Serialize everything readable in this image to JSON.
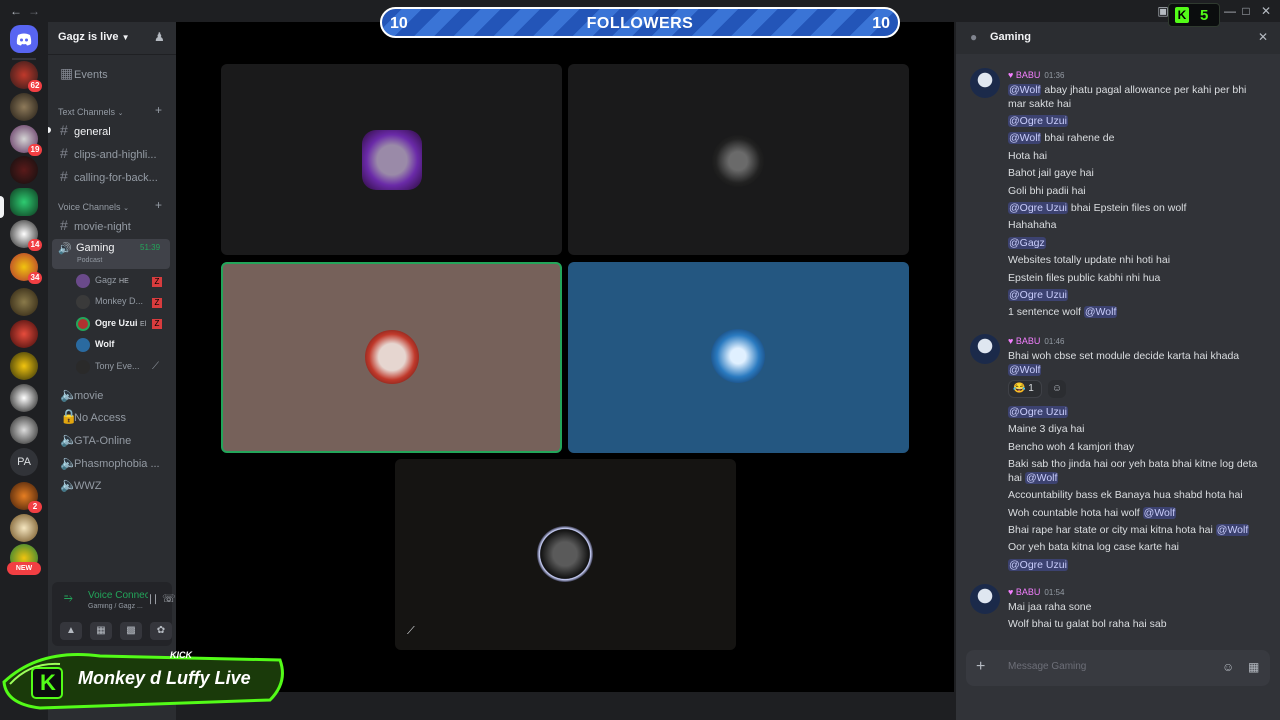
{
  "overlay": {
    "followers_label": "FOLLOWERS",
    "followers_left": "10",
    "followers_right": "10",
    "kick_count": "5",
    "kick_logo": "K",
    "brand_top": "KICK",
    "brand_name": "Monkey d Luffy Live",
    "brand_letter": "K"
  },
  "colors": {
    "accent": "#53fc18",
    "brand": "#5865f2",
    "mention_bg": "#3c4270",
    "live_red": "#f23f43"
  },
  "rail": {
    "badges": [
      "62",
      "19",
      "14",
      "34",
      "2"
    ],
    "pa_label": "PA",
    "new_label": "NEW"
  },
  "sidebar": {
    "server_name": "Gagz is live",
    "events": "Events",
    "text_cat": "Text Channels",
    "text_channels": [
      "general",
      "clips-and-highli...",
      "calling-for-back..."
    ],
    "voice_cat": "Voice Channels",
    "voice_channels": {
      "movie_night": "movie-night",
      "gaming": "Gaming",
      "gaming_timer": "51:39",
      "gaming_sub": "Podcast",
      "members": [
        "Gagz",
        "Monkey D...",
        "Ogre Uzui",
        "Wolf",
        "Tony Eve..."
      ],
      "member_tags": [
        "HE",
        "",
        "El",
        "",
        ""
      ],
      "others": [
        "movie",
        "No Access",
        "GTA-Online",
        "Phasmophobia ...",
        "WWZ"
      ]
    },
    "voice_status": "Voice Connected",
    "voice_location": "Gaming / Gagz ..."
  },
  "chat": {
    "channel": "Gaming",
    "input_placeholder": "Message Gaming",
    "groups": [
      {
        "author": "BABU",
        "time": "01:36",
        "lines": [
          {
            "mention": "@Wolf",
            "text": " abay jhatu pagal allowance per kahi per bhi mar sakte hai",
            "after": ""
          },
          {
            "mention": "@Ogre Uzui",
            "text": "",
            "after": ""
          },
          {
            "mention": "@Wolf",
            "text": " bhai rahene de",
            "after": ""
          },
          {
            "mention": "",
            "text": "Hota hai",
            "after": ""
          },
          {
            "mention": "",
            "text": "Bahot jail gaye hai",
            "after": ""
          },
          {
            "mention": "",
            "text": "Goli bhi padii hai",
            "after": ""
          },
          {
            "mention": "@Ogre Uzui",
            "text": " bhai Epstein files on wolf",
            "after": ""
          },
          {
            "mention": "",
            "text": "Hahahaha",
            "after": ""
          },
          {
            "mention": "@Gagz",
            "text": "",
            "after": ""
          },
          {
            "mention": "",
            "text": "Websites totally update nhi hoti hai",
            "after": ""
          },
          {
            "mention": "",
            "text": "Epstein files public kabhi nhi hua",
            "after": ""
          },
          {
            "mention": "@Ogre Uzui",
            "text": "",
            "after": ""
          },
          {
            "mention": "",
            "text": "1 sentence wolf ",
            "after": "@Wolf"
          }
        ]
      },
      {
        "author": "BABU",
        "time": "01:46",
        "lines": [
          {
            "mention": "",
            "text": "Bhai woh cbse set module decide karta hai khada ",
            "after": "@Wolf"
          }
        ],
        "reaction_count": "1",
        "lines2": [
          {
            "mention": "@Ogre Uzui",
            "text": "",
            "after": ""
          },
          {
            "mention": "",
            "text": "Maine 3 diya hai",
            "after": ""
          },
          {
            "mention": "",
            "text": "Bencho woh 4 kamjori thay",
            "after": ""
          },
          {
            "mention": "",
            "text": "Baki sab tho jinda hai oor yeh bata bhai kitne log deta hai ",
            "after": "@Wolf"
          },
          {
            "mention": "",
            "text": "Accountability bass ek Banaya hua shabd hota hai",
            "after": ""
          },
          {
            "mention": "",
            "text": "Woh countable hota hai wolf ",
            "after": "@Wolf"
          },
          {
            "mention": "",
            "text": "Bhai rape har state or city mai kitna hota hai ",
            "after": "@Wolf"
          },
          {
            "mention": "",
            "text": "Oor yeh bata kitna log case karte hai",
            "after": ""
          },
          {
            "mention": "@Ogre Uzui",
            "text": "",
            "after": ""
          }
        ]
      },
      {
        "author": "BABU",
        "time": "01:54",
        "lines": [
          {
            "mention": "",
            "text": "Mai jaa raha sone",
            "after": ""
          },
          {
            "mention": "",
            "text": "Wolf bhai tu galat bol raha hai sab",
            "after": ""
          }
        ]
      }
    ]
  }
}
